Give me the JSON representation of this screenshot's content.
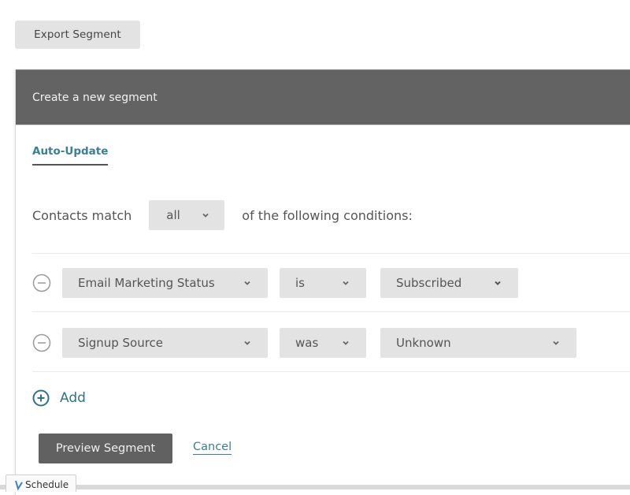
{
  "toolbar": {
    "export_label": "Export Segment"
  },
  "panel": {
    "title": "Create a new segment",
    "tabs": [
      {
        "label": "Auto-Update",
        "active": true
      }
    ],
    "match": {
      "prefix": "Contacts match",
      "selected": "all",
      "suffix": "of the following conditions:"
    },
    "conditions": [
      {
        "field": "Email Marketing Status",
        "operator": "is",
        "value": "Subscribed"
      },
      {
        "field": "Signup Source",
        "operator": "was",
        "value": "Unknown"
      }
    ],
    "add_label": "Add",
    "preview_label": "Preview Segment",
    "cancel_label": "Cancel"
  },
  "footer": {
    "schedule_tab_label": "Schedule"
  },
  "colors": {
    "header_bg": "#636363",
    "accent_link": "#3a7f95",
    "select_bg": "#e3e3e3",
    "primary_button_bg": "#616161"
  }
}
